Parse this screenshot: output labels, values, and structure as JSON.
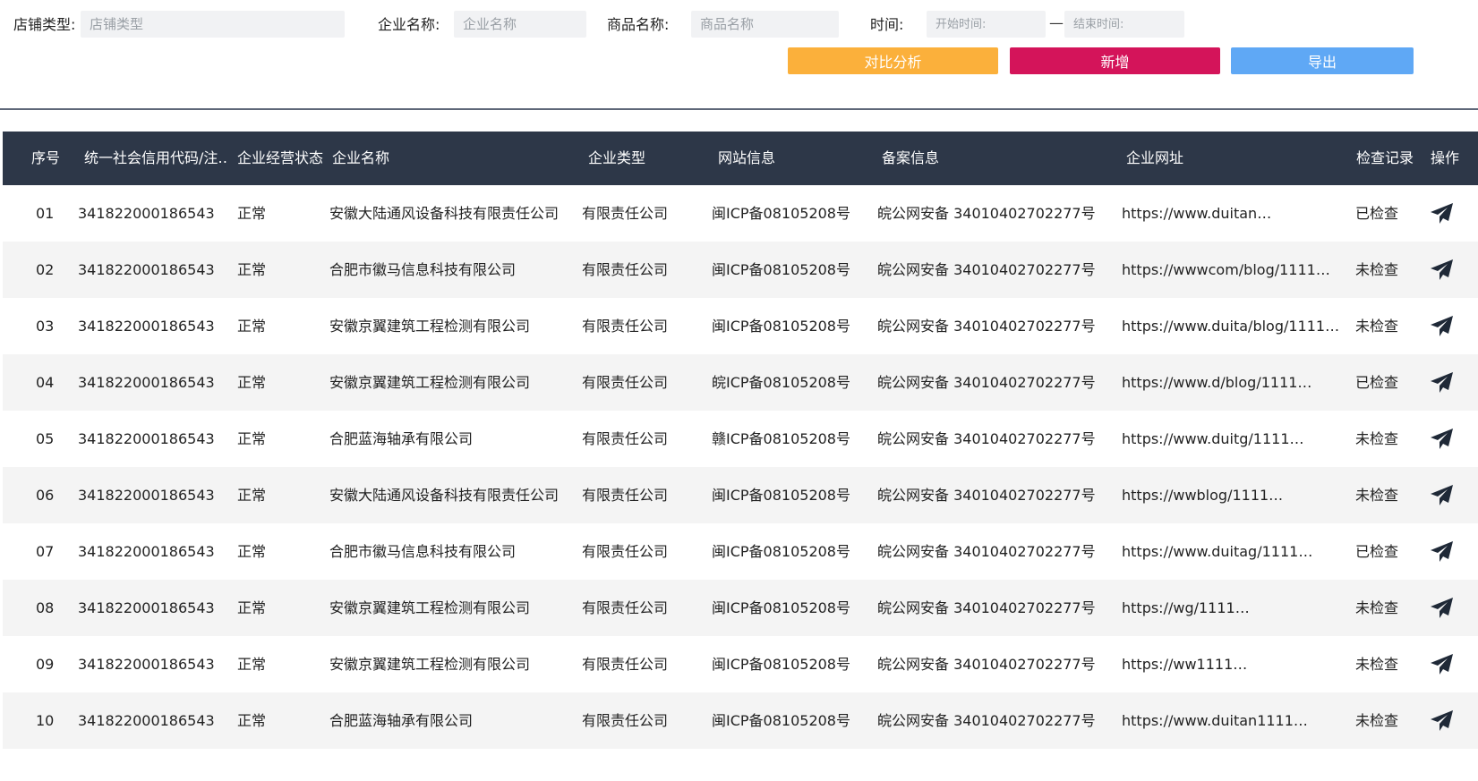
{
  "filters": {
    "shop_type": {
      "label": "店铺类型:",
      "placeholder": "店铺类型",
      "value": ""
    },
    "company_name": {
      "label": "企业名称:",
      "placeholder": "企业名称",
      "value": ""
    },
    "product_name": {
      "label": "商品名称:",
      "placeholder": "商品名称",
      "value": ""
    },
    "time": {
      "label": "时间:",
      "start_placeholder": "开始时间:",
      "end_placeholder": "结束时间:",
      "separator": "—"
    }
  },
  "buttons": {
    "compare": {
      "label": "对比分析",
      "color": "#fbb03b"
    },
    "add": {
      "label": "新增",
      "color": "#d4145a"
    },
    "export": {
      "label": "导出",
      "color": "#5fa8f5"
    }
  },
  "table": {
    "header_bg": "#2d3748",
    "columns": [
      "序号",
      "统一社会信用代码/注…",
      "企业经营状态",
      "企业名称",
      "企业类型",
      "网站信息",
      "备案信息",
      "企业网址",
      "检查记录",
      "操作"
    ],
    "rows": [
      {
        "no": "01",
        "code": "341822000186543",
        "status": "正常",
        "name": "安徽大陆通风设备科技有限责任公司",
        "type": "有限责任公司",
        "icp": "闽ICP备08105208号",
        "record": "皖公网安备 34010402702277号",
        "url": "https://www.duitan…",
        "check": "已检查",
        "action_icon": "send-icon"
      },
      {
        "no": "02",
        "code": "341822000186543",
        "status": "正常",
        "name": "合肥市徽马信息科技有限公司",
        "type": "有限责任公司",
        "icp": "闽ICP备08105208号",
        "record": "皖公网安备 34010402702277号",
        "url": "https://wwwcom/blog/1111…",
        "check": "未检查",
        "action_icon": "send-icon"
      },
      {
        "no": "03",
        "code": "341822000186543",
        "status": "正常",
        "name": "安徽京翼建筑工程检测有限公司",
        "type": "有限责任公司",
        "icp": "闽ICP备08105208号",
        "record": "皖公网安备 34010402702277号",
        "url": "https://www.duita/blog/1111…",
        "check": "未检查",
        "action_icon": "send-icon"
      },
      {
        "no": "04",
        "code": "341822000186543",
        "status": "正常",
        "name": "安徽京翼建筑工程检测有限公司",
        "type": "有限责任公司",
        "icp": "皖ICP备08105208号",
        "record": "皖公网安备 34010402702277号",
        "url": "https://www.d/blog/1111…",
        "check": "已检查",
        "action_icon": "send-icon"
      },
      {
        "no": "05",
        "code": "341822000186543",
        "status": "正常",
        "name": "合肥蓝海轴承有限公司",
        "type": "有限责任公司",
        "icp": "赣ICP备08105208号",
        "record": "皖公网安备 34010402702277号",
        "url": "https://www.duitg/1111…",
        "check": "未检查",
        "action_icon": "send-icon"
      },
      {
        "no": "06",
        "code": "341822000186543",
        "status": "正常",
        "name": "安徽大陆通风设备科技有限责任公司",
        "type": "有限责任公司",
        "icp": "闽ICP备08105208号",
        "record": "皖公网安备 34010402702277号",
        "url": "https://wwblog/1111…",
        "check": "未检查",
        "action_icon": "send-icon"
      },
      {
        "no": "07",
        "code": "341822000186543",
        "status": "正常",
        "name": "合肥市徽马信息科技有限公司",
        "type": "有限责任公司",
        "icp": "闽ICP备08105208号",
        "record": "皖公网安备 34010402702277号",
        "url": "https://www.duitag/1111…",
        "check": "已检查",
        "action_icon": "send-icon"
      },
      {
        "no": "08",
        "code": "341822000186543",
        "status": "正常",
        "name": "安徽京翼建筑工程检测有限公司",
        "type": "有限责任公司",
        "icp": "闽ICP备08105208号",
        "record": "皖公网安备 34010402702277号",
        "url": "https://wg/1111…",
        "check": "未检查",
        "action_icon": "send-icon"
      },
      {
        "no": "09",
        "code": "341822000186543",
        "status": "正常",
        "name": "安徽京翼建筑工程检测有限公司",
        "type": "有限责任公司",
        "icp": "闽ICP备08105208号",
        "record": "皖公网安备 34010402702277号",
        "url": "https://ww1111…",
        "check": "未检查",
        "action_icon": "send-icon"
      },
      {
        "no": "10",
        "code": "341822000186543",
        "status": "正常",
        "name": "合肥蓝海轴承有限公司",
        "type": "有限责任公司",
        "icp": "闽ICP备08105208号",
        "record": "皖公网安备 34010402702277号",
        "url": "https://www.duitan1111…",
        "check": "未检查",
        "action_icon": "send-icon"
      }
    ]
  }
}
